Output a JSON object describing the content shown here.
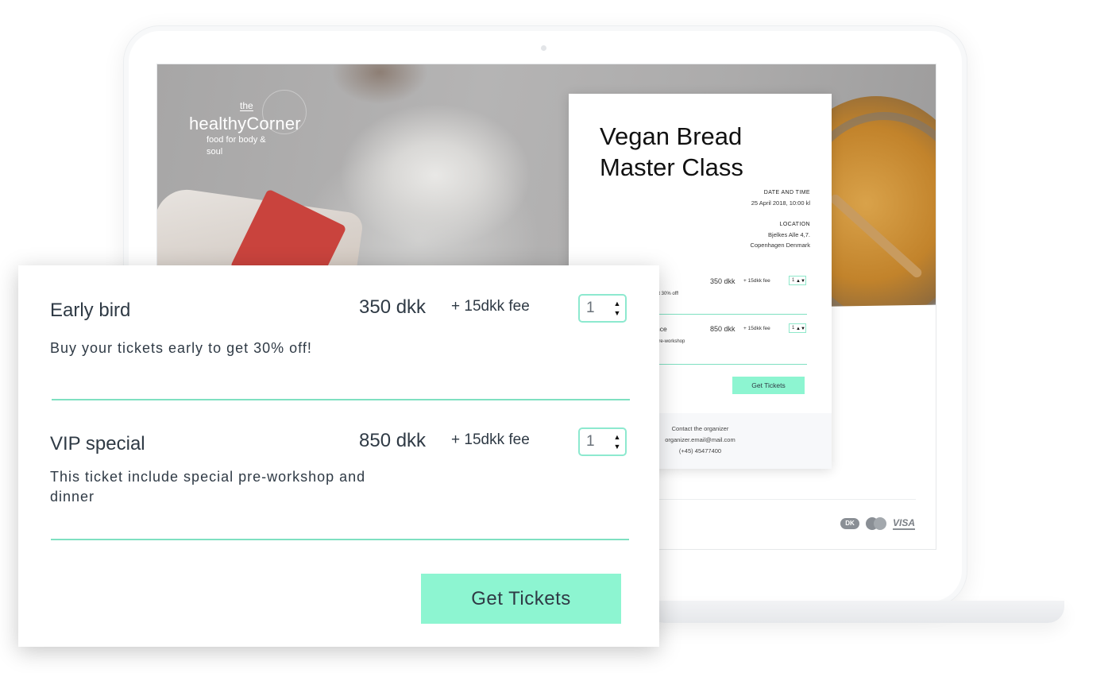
{
  "logo": {
    "the": "the",
    "name": "healthyCorner",
    "tagline": "food for body & soul"
  },
  "event": {
    "title": "Vegan Bread Master Class",
    "date_label": "DATE AND TIME",
    "date_value": "25 April 2018, 10:00 kl",
    "location_label": "LOCATION",
    "location_line1": "Bjelkes Alle 4,7.",
    "location_line2": "Copenhagen Denmark"
  },
  "mini_tickets": [
    {
      "name": "",
      "description": "et 30% off!",
      "price": "350 dkk",
      "fee": "+ 15dkk fee",
      "quantity": "1"
    },
    {
      "name": "nce",
      "description": "pre-workshop",
      "price": "850 dkk",
      "fee": "+ 15dkk fee",
      "quantity": "1"
    }
  ],
  "mini_button": "Get Tickets",
  "organizer": {
    "label": "Contact the organizer",
    "email": "organizer.email@mail.com",
    "phone": "(+45) 45477400"
  },
  "payment_icons": [
    "dankort-icon",
    "mastercard-icon",
    "visa-icon"
  ],
  "payment": {
    "dankort": "DK",
    "visa": "VISA"
  },
  "tickets": [
    {
      "name": "Early bird",
      "price": "350 dkk",
      "fee": "+ 15dkk fee",
      "description": "Buy your tickets early to get 30% off!",
      "quantity": "1"
    },
    {
      "name": "VIP special",
      "price": "850 dkk",
      "fee": "+ 15dkk fee",
      "description": "This ticket include special pre-workshop and dinner",
      "quantity": "1"
    }
  ],
  "get_tickets_label": "Get Tickets",
  "colors": {
    "accent": "#8df5d1",
    "divider": "#7fe0c1",
    "text": "#2f3a45"
  }
}
